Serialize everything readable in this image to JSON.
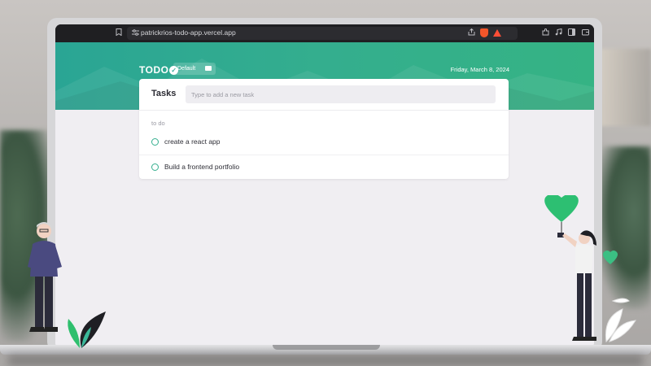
{
  "browser": {
    "url": "patrickrios-todo-app.vercel.app",
    "icons": [
      "bookmark-icon",
      "site-settings-icon",
      "share-icon",
      "brave-shields-icon",
      "brave-rewards-icon",
      "extensions-icon",
      "media-icon",
      "sidebar-icon",
      "wallet-icon"
    ]
  },
  "app": {
    "logo": "TODO",
    "folder_label": "Default",
    "date": "Friday, March 8, 2024",
    "card_title": "Tasks",
    "input_placeholder": "Type to add a new task",
    "section_label": "to do",
    "tasks": [
      {
        "text": "create a react app",
        "done": false
      },
      {
        "text": "Build a frontend portfolio",
        "done": false
      }
    ]
  },
  "colors": {
    "accent": "#34ae8e",
    "hero_start": "#2aa594",
    "hero_end": "#35b384",
    "page_bg": "#f0eef2"
  }
}
